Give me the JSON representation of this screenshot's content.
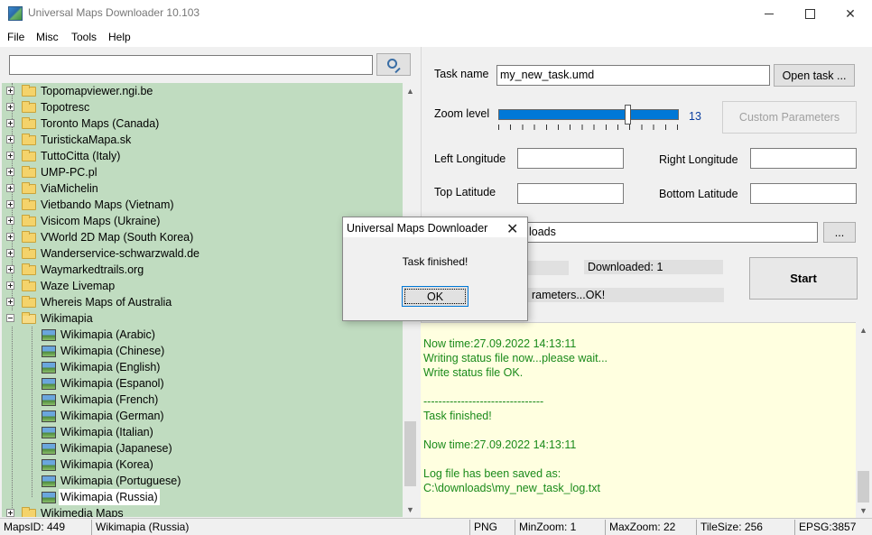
{
  "window": {
    "title": "Universal Maps Downloader 10.103",
    "min_glyph": "",
    "max_glyph": "",
    "close_glyph": "✕"
  },
  "menu": [
    "File",
    "Misc",
    "Tools",
    "Help"
  ],
  "search": {
    "value": "",
    "placeholder": ""
  },
  "tree": {
    "folders": [
      "Topomapviewer.ngi.be",
      "Topotresc",
      "Toronto Maps (Canada)",
      "TuristickaMapa.sk",
      "TuttoCitta (Italy)",
      "UMP-PC.pl",
      "ViaMichelin",
      "Vietbando Maps (Vietnam)",
      "Visicom Maps (Ukraine)",
      "VWorld 2D Map (South Korea)",
      "Wanderservice-schwarzwald.de",
      "Waymarkedtrails.org",
      "Waze Livemap",
      "Whereis Maps of Australia"
    ],
    "expanded_folder": "Wikimapia",
    "children": [
      "Wikimapia (Arabic)",
      "Wikimapia (Chinese)",
      "Wikimapia (English)",
      "Wikimapia (Espanol)",
      "Wikimapia (French)",
      "Wikimapia (German)",
      "Wikimapia (Italian)",
      "Wikimapia (Japanese)",
      "Wikimapia (Korea)",
      "Wikimapia (Portuguese)",
      "Wikimapia (Russia)"
    ],
    "selected_child": "Wikimapia (Russia)",
    "next_folder": "Wikimedia Maps"
  },
  "task": {
    "name_label": "Task name",
    "name_value": "my_new_task.umd",
    "open_button": "Open task ...",
    "zoom_label": "Zoom level",
    "zoom_value": "13",
    "zoom_level": 13,
    "custom_params_button": "Custom Parameters",
    "left_longitude_label": "Left Longitude",
    "right_longitude_label": "Right Longitude",
    "top_latitude_label": "Top Latitude",
    "bottom_latitude_label": "Bottom Latitude",
    "left_longitude_value": "",
    "right_longitude_value": "",
    "top_latitude_value": "",
    "bottom_latitude_value": "",
    "path_value_visible": "loads",
    "browse_button": "...",
    "downloaded_text": "Downloaded: 1",
    "params_text": "rameters...OK!",
    "start_button": "Start"
  },
  "log": {
    "lines": [
      "Now time:27.09.2022 14:13:11",
      "Writing status file now...please wait...",
      "Write status file OK.",
      "",
      "--------------------------------",
      "Task finished!",
      "",
      "Now time:27.09.2022 14:13:11",
      "",
      "Log file has been saved as:",
      "C:\\downloads\\my_new_task_log.txt"
    ],
    "text_color": "#1a8a1a"
  },
  "statusbar": {
    "maps_id": "MapsID: 449",
    "map_name": "Wikimapia (Russia)",
    "format": "PNG",
    "min_zoom": "MinZoom: 1",
    "max_zoom": "MaxZoom: 22",
    "tile_size": "TileSize: 256",
    "epsg": "EPSG:3857"
  },
  "dialog": {
    "title": "Universal Maps Downloader",
    "close_glyph": "✕",
    "message": "Task finished!",
    "ok_button": "OK"
  },
  "colors": {
    "tree_bg": "#c0dcc0",
    "log_bg": "#ffffe0",
    "accent": "#0078d7"
  }
}
